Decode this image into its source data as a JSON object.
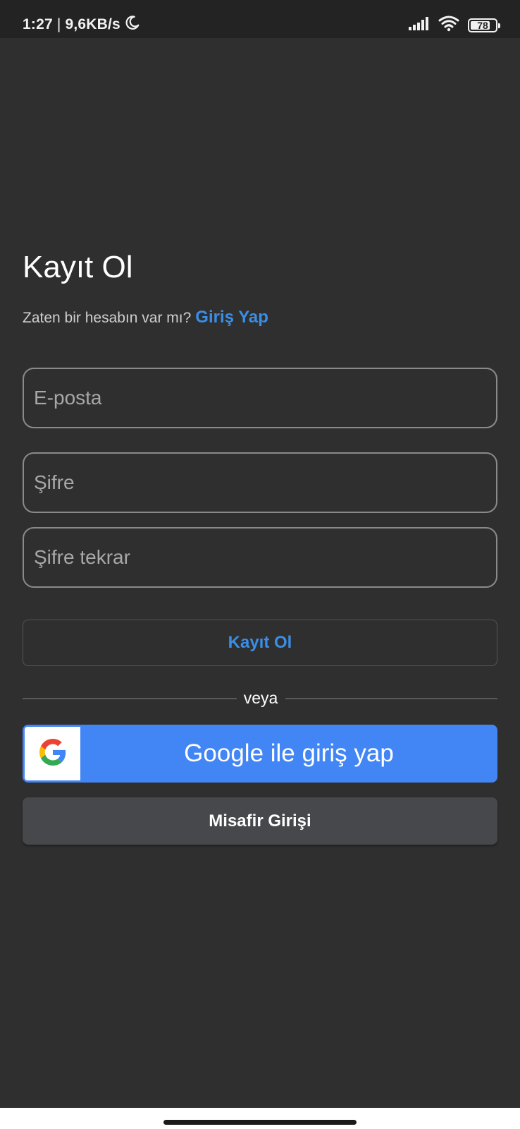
{
  "status_bar": {
    "time": "1:27",
    "separator": "|",
    "net_speed": "9,6KB/s",
    "battery_level": "78",
    "battery_fraction": 0.78,
    "icons": [
      "moon-icon",
      "signal-icon",
      "wifi-icon",
      "battery-icon"
    ]
  },
  "signup": {
    "title": "Kayıt Ol",
    "have_account_text": "Zaten bir hesabın var mı?",
    "login_link": "Giriş Yap",
    "email_placeholder": "E-posta",
    "email_value": "",
    "password_placeholder": "Şifre",
    "password_value": "",
    "password_repeat_placeholder": "Şifre tekrar",
    "password_repeat_value": "",
    "register_button": "Kayıt Ol",
    "divider_text": "veya",
    "google_button": "Google ile giriş yap",
    "guest_button": "Misafir Girişi"
  },
  "colors": {
    "background": "#2f2f30",
    "accent": "#3a8ee6",
    "google_blue": "#4285f4",
    "guest_button": "#47484c"
  }
}
